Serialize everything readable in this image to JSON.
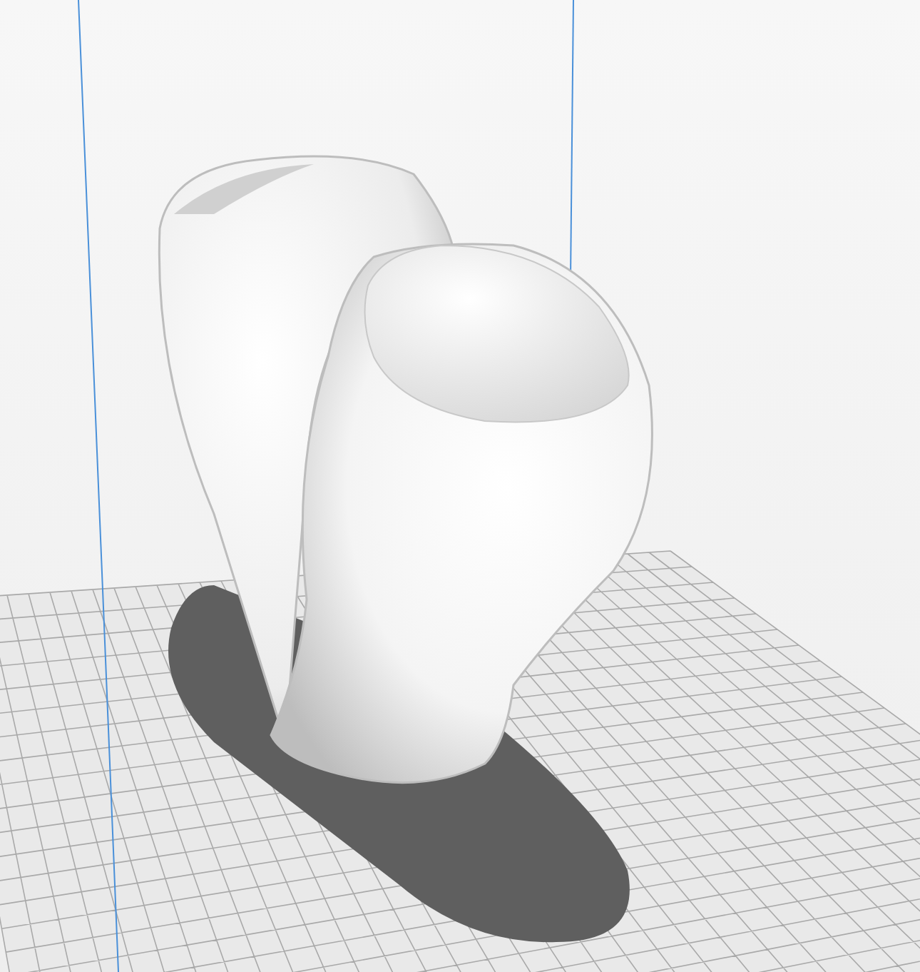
{
  "viewport": {
    "kind": "build-plate-scene"
  }
}
